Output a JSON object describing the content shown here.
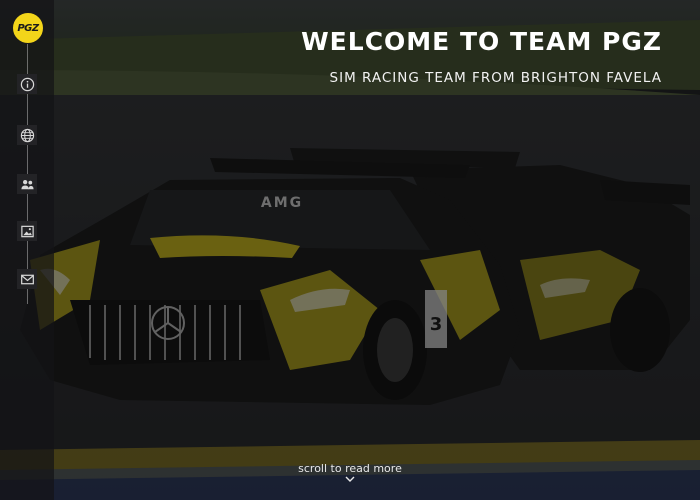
{
  "hero": {
    "title": "WELCOME TO TEAM PGZ",
    "subtitle": "SIM RACING TEAM FROM BRIGHTON FAVELA",
    "scroll_label": "scroll to read more",
    "car_brand": "AMG",
    "car_number": "3",
    "car_colors": {
      "body": "#141414",
      "accent": "#d7c81c"
    }
  },
  "sidebar": {
    "logo_text": "PGZ",
    "logo_color": "#f3d51a",
    "icons": [
      "info-icon",
      "globe-icon",
      "team-icon",
      "gallery-icon",
      "mail-icon"
    ]
  }
}
